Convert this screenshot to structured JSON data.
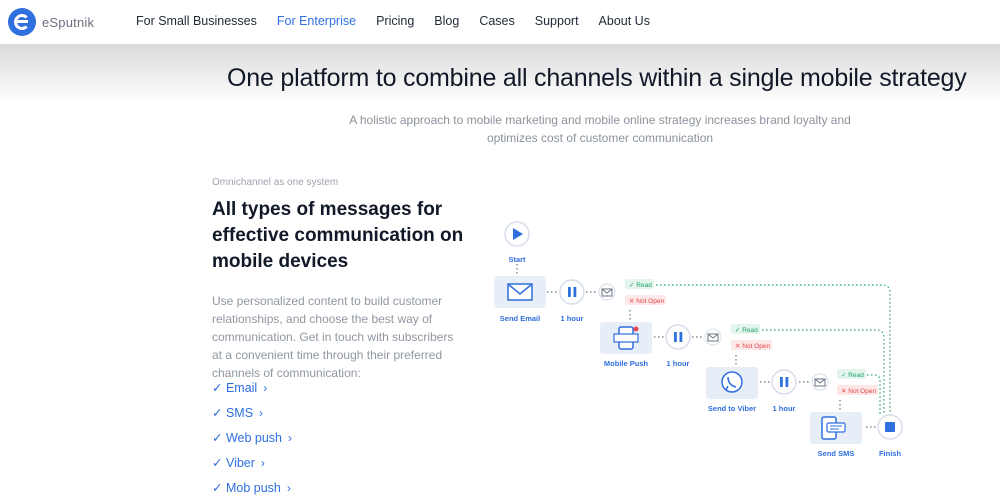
{
  "header": {
    "brand": "eSputnik",
    "nav": [
      "For Small Businesses",
      "For Enterprise",
      "Pricing",
      "Blog",
      "Cases",
      "Support",
      "About Us"
    ],
    "active_nav": "For Enterprise"
  },
  "hero": {
    "headline": "One platform to combine all channels within a single mobile strategy",
    "subline": "A holistic approach to mobile marketing and mobile online strategy increases brand loyalty and optimizes cost of customer communication"
  },
  "section": {
    "eyebrow": "Omnichannel as one system",
    "title": "All types of messages for effective communication on mobile devices",
    "body": "Use personalized content to build customer relationships, and choose the best way of communication. Get in touch with subscribers at a convenient time through their preferred channels of communication:",
    "channels": [
      "Email",
      "SMS",
      "Web push",
      "Viber",
      "Mob push"
    ]
  },
  "flow": {
    "start": "Start",
    "finish": "Finish",
    "steps": [
      {
        "label": "Send Email",
        "wait": "1 hour",
        "read": "Read",
        "not_open": "Not Open",
        "icon": "envelope-icon"
      },
      {
        "label": "Mobile Push",
        "wait": "1 hour",
        "read": "Read",
        "not_open": "Not Open",
        "icon": "mobile-push-icon"
      },
      {
        "label": "Send to Viber",
        "wait": "1 hour",
        "read": "Read",
        "not_open": "Not Open",
        "icon": "viber-icon"
      },
      {
        "label": "Send SMS",
        "icon": "sms-icon"
      }
    ]
  },
  "colors": {
    "accent": "#2f6fde",
    "read_green": "#22a06b",
    "not_open_red": "#e5484d",
    "node_bg": "#e8eef8"
  }
}
